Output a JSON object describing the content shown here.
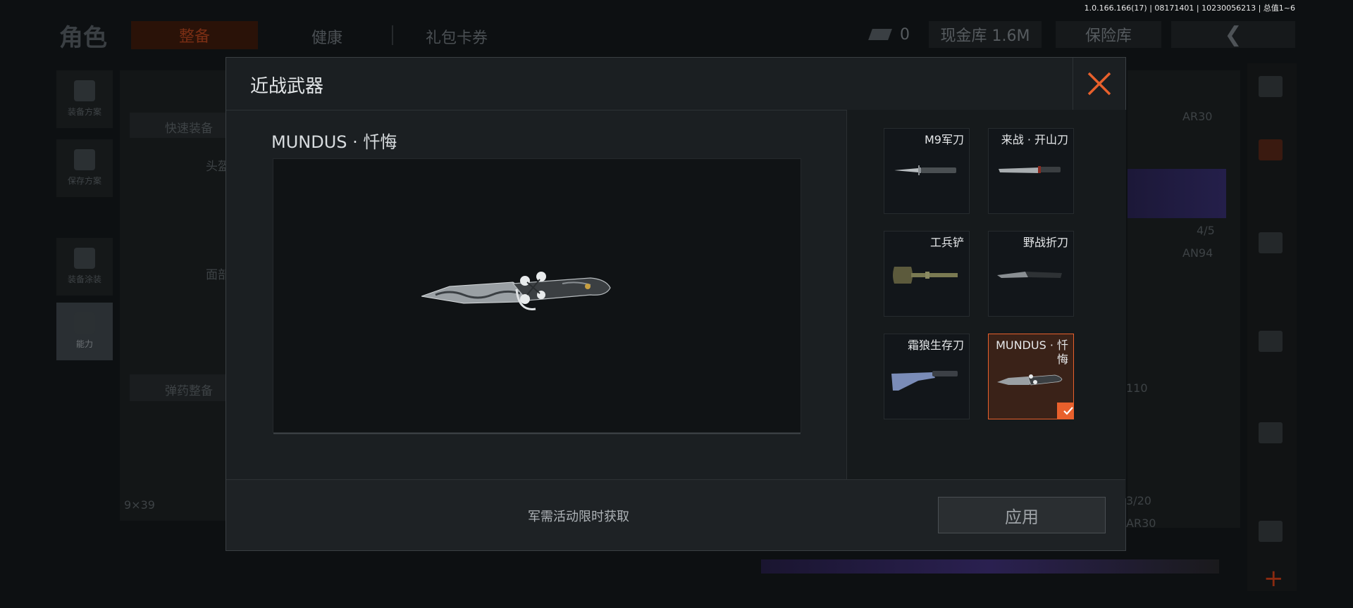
{
  "version_text": "1.0.166.166(17) | 08171401 | 10230056213 | 总值1~6",
  "background": {
    "title": "角色",
    "tabs": [
      "整备",
      "健康",
      "礼包卡券"
    ],
    "currency_count": "0",
    "cash_label": "现金库 1.6M",
    "safe_label": "保险库",
    "left_buttons": [
      "装备方案",
      "保存方案",
      "装备涂装",
      "能力"
    ],
    "quick_equip": "快速装备",
    "ammo_equip": "弹药整备",
    "slot_labels": [
      "头盔",
      "面部"
    ],
    "ammo_caliber": "9×39",
    "right_labels": [
      "AR30",
      "4/5",
      "AN94",
      "110",
      "3/20",
      "AR30"
    ]
  },
  "modal": {
    "title": "近战武器",
    "selected_weapon_name": "MUNDUS · 忏悔",
    "items": [
      {
        "label": "M9军刀",
        "icon": "bayonet-icon",
        "selected": false
      },
      {
        "label": "来战 · 开山刀",
        "icon": "machete-icon",
        "selected": false
      },
      {
        "label": "工兵铲",
        "icon": "shovel-icon",
        "selected": false
      },
      {
        "label": "野战折刀",
        "icon": "folding-knife-icon",
        "selected": false
      },
      {
        "label": "霜狼生存刀",
        "icon": "survival-knife-icon",
        "selected": false
      },
      {
        "label": "MUNDUS · 忏悔",
        "icon": "ornate-knife-icon",
        "selected": true
      }
    ],
    "footer_note": "军需活动限时获取",
    "apply_label": "应用"
  },
  "colors": {
    "accent": "#e8602c",
    "modal_bg": "#1b1f22",
    "page_bg": "#0d1012"
  }
}
